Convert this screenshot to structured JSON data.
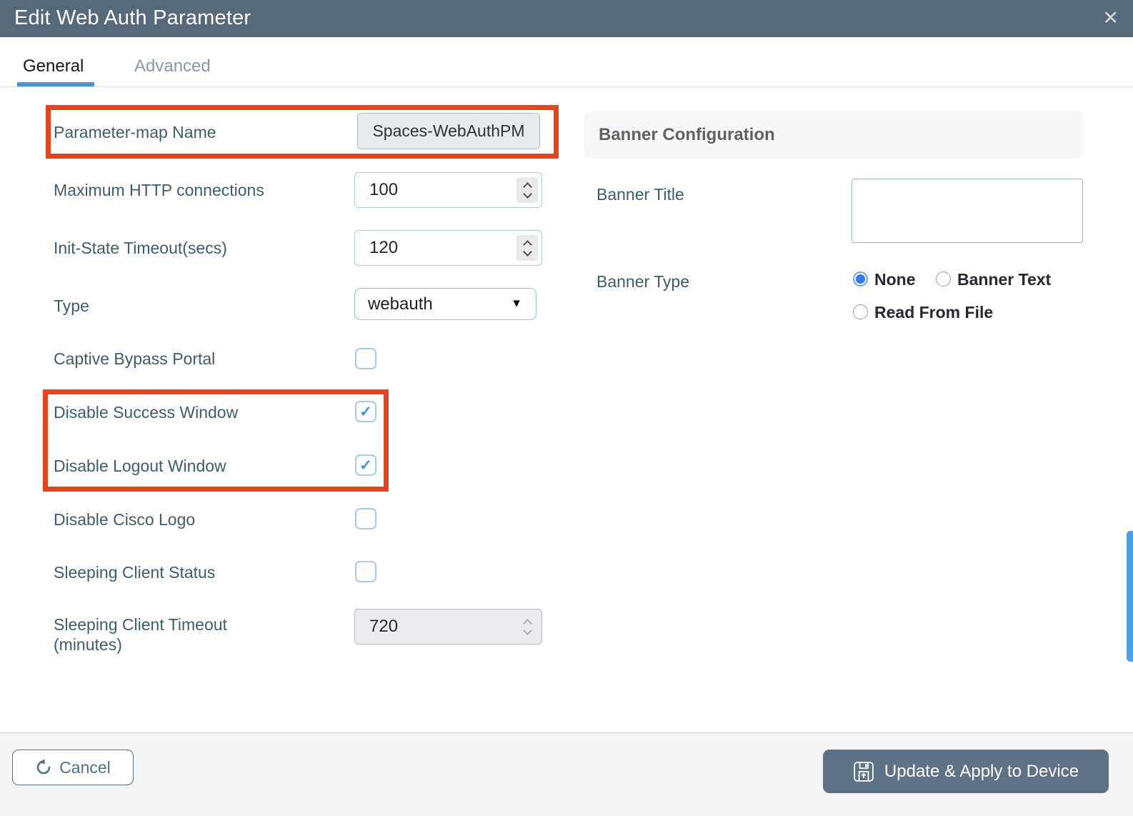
{
  "window": {
    "title": "Edit Web Auth Parameter",
    "close_icon": "✕"
  },
  "tabs": {
    "general": {
      "label": "General",
      "active": true
    },
    "advanced": {
      "label": "Advanced",
      "active": false
    }
  },
  "form": {
    "check_glyph": "✓",
    "parameter_map": {
      "label": "Parameter-map Name",
      "value": "Spaces-WebAuthPM",
      "readonly": true
    },
    "max_http_connections": {
      "label": "Maximum HTTP connections",
      "value": "100"
    },
    "init_state_timeout": {
      "label": "Init-State Timeout(secs)",
      "value": "120"
    },
    "type": {
      "label": "Type",
      "value": "webauth",
      "dropdown_icon": "▼"
    },
    "captive_bypass_portal": {
      "label": "Captive Bypass Portal",
      "checked": false
    },
    "disable_success_window": {
      "label": "Disable Success Window",
      "checked": true
    },
    "disable_logout_window": {
      "label": "Disable Logout Window",
      "checked": true
    },
    "disable_cisco_logo": {
      "label": "Disable Cisco Logo",
      "checked": false
    },
    "sleeping_client_status": {
      "label": "Sleeping Client Status",
      "checked": false
    },
    "sleeping_client_timeout": {
      "label_line1": "Sleeping Client Timeout",
      "label_line2": "(minutes)",
      "value": "720",
      "disabled": true
    }
  },
  "banner": {
    "section_title": "Banner Configuration",
    "title_label": "Banner Title",
    "title_value": "",
    "type_label": "Banner Type",
    "type_options": [
      {
        "label": "None",
        "selected": true
      },
      {
        "label": "Banner Text",
        "selected": false
      },
      {
        "label": "Read From File",
        "selected": false
      }
    ]
  },
  "footer": {
    "cancel_label": "Cancel",
    "apply_label": "Update & Apply to Device"
  },
  "colors": {
    "header_bg": "#56697a",
    "highlight_orange": "#e8441b",
    "tab_underline": "#4a96d2",
    "checkbox_check": "#3f90e2",
    "radio_selected": "#2e7bf0",
    "apply_button_bg": "#5d7284",
    "scrollbar_thumb": "#4aa0e8"
  }
}
